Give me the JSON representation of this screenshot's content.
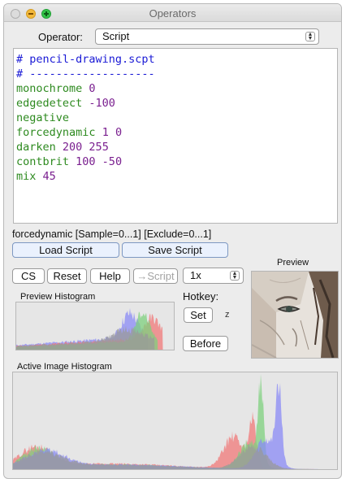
{
  "window": {
    "title": "Operators"
  },
  "operator": {
    "label": "Operator:",
    "value": "Script"
  },
  "script_lines": [
    {
      "k": "comment",
      "t": "# pencil-drawing.scpt"
    },
    {
      "k": "comment",
      "t": "# -------------------"
    },
    {
      "cmd": "monochrome",
      "args": "0"
    },
    {
      "cmd": "edgedetect",
      "args": "-100"
    },
    {
      "cmd": "negative",
      "args": ""
    },
    {
      "cmd": "forcedynamic",
      "args": "1 0"
    },
    {
      "cmd": "darken",
      "args": "200 255"
    },
    {
      "cmd": "contbrit",
      "args": "100 -50"
    },
    {
      "cmd": "mix",
      "args": "45"
    }
  ],
  "status": "forcedynamic [Sample=0...1] [Exclude=0...1]",
  "buttons": {
    "load_script": "Load Script",
    "save_script": "Save Script",
    "cs": "CS",
    "reset": "Reset",
    "help": "Help",
    "to_script": "→Script",
    "set": "Set",
    "before": "Before"
  },
  "zoom": {
    "value": "1x"
  },
  "hotkey": {
    "label": "Hotkey:",
    "key": "z"
  },
  "preview": {
    "label": "Preview"
  },
  "preview_histogram": {
    "label": "Preview Histogram"
  },
  "active_histogram": {
    "label": "Active Image Histogram"
  },
  "colors": {
    "red": "#f07878",
    "green": "#7ed07e",
    "blue": "#8a8af5",
    "gray": "#9a9a9a"
  }
}
